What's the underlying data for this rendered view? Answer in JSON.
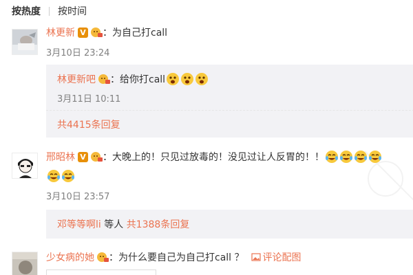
{
  "sort": {
    "active": "按热度",
    "other": "按时间"
  },
  "comments": [
    {
      "username": "林更新",
      "text": "：为自己打call",
      "time": "3月10日 23:24",
      "reply": {
        "username": "林更新吧",
        "text": "：给你打call",
        "time": "3月11日 10:11"
      },
      "more": "共4415条回复"
    },
    {
      "username": "邢昭林",
      "text": "：大晚上的！只见过放毒的！没见过让人反胃的！！",
      "time": "3月10日 23:57",
      "more_users": "邓等等啊li",
      "more_mid": " 等人 ",
      "more": "共1388条回复"
    },
    {
      "username": "少女病的她",
      "text": "：为什么要自己为自己打call ？",
      "pic_label": "评论配图"
    }
  ],
  "colors": {
    "link": "#eb7350",
    "time": "#808080",
    "reply_bg": "#f2f2f5"
  }
}
